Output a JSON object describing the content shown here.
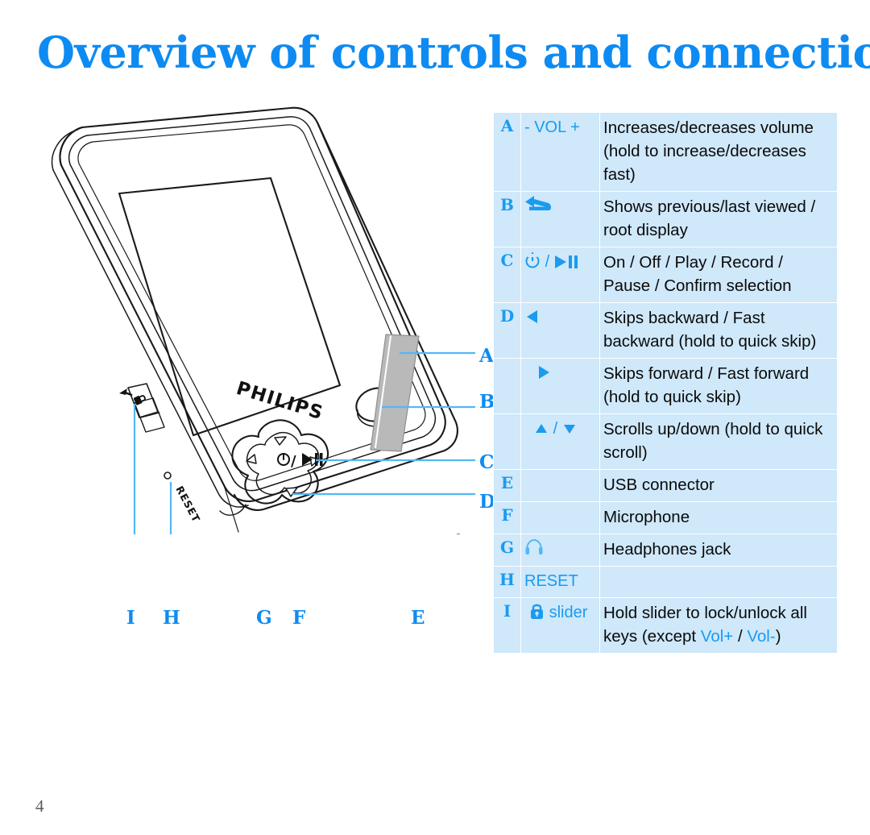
{
  "page": {
    "title": "Overview of controls and connections",
    "number": "4",
    "title_color": "#0d8bf2",
    "table_bg_color": "#cfe8fa",
    "accent_color": "#1a9bf0"
  },
  "figure": {
    "brand_label": "PHILIPS",
    "reset_label": "RESET",
    "center_button_label": "/",
    "callouts": [
      {
        "letter": "A",
        "target": "volume-strip"
      },
      {
        "letter": "B",
        "target": "back-button"
      },
      {
        "letter": "C",
        "target": "power-play-button"
      },
      {
        "letter": "D",
        "target": "navigation-pad"
      },
      {
        "letter": "E",
        "target": "usb-connector"
      },
      {
        "letter": "F",
        "target": "microphone"
      },
      {
        "letter": "G",
        "target": "headphones-jack"
      },
      {
        "letter": "H",
        "target": "reset-hole"
      },
      {
        "letter": "I",
        "target": "lock-slider"
      }
    ]
  },
  "table": {
    "rows": [
      {
        "letter": "A",
        "symbol_text": "- VOL +",
        "symbol_icon": "",
        "description": "Increases/decreases volume (hold to increase/decreases fast)"
      },
      {
        "letter": "B",
        "symbol_text": "",
        "symbol_icon": "back-arrow-icon",
        "description": "Shows previous/last viewed / root display"
      },
      {
        "letter": "C",
        "symbol_text": "/",
        "symbol_icon": "power-icon, play-pause-icon",
        "description": "On / Off / Play / Record / Pause / Confirm selection"
      },
      {
        "letter": "D",
        "symbol_text": "",
        "symbol_icon": "triangle-left-icon",
        "description": "Skips backward / Fast backward (hold to quick skip)"
      },
      {
        "letter": "",
        "symbol_text": "",
        "symbol_icon": "triangle-right-icon",
        "description": "Skips forward / Fast forward (hold to quick skip)"
      },
      {
        "letter": "",
        "symbol_text": "/",
        "symbol_icon": "triangle-up-icon, triangle-down-icon",
        "description": "Scrolls up/down (hold to quick scroll)"
      },
      {
        "letter": "E",
        "symbol_text": "",
        "symbol_icon": "",
        "description": "USB connector"
      },
      {
        "letter": "F",
        "symbol_text": "",
        "symbol_icon": "",
        "description": "Microphone"
      },
      {
        "letter": "G",
        "symbol_text": "",
        "symbol_icon": "headphones-icon",
        "description": "Headphones jack"
      },
      {
        "letter": "H",
        "symbol_text": "RESET",
        "symbol_icon": "",
        "description": ""
      },
      {
        "letter": "I",
        "symbol_text": "slider",
        "symbol_icon": "lock-icon",
        "description_parts": [
          {
            "text": "Hold slider to lock/unlock all keys (except ",
            "accent": false
          },
          {
            "text": "Vol+",
            "accent": true
          },
          {
            "text": " / ",
            "accent": false
          },
          {
            "text": "Vol-",
            "accent": true
          },
          {
            "text": ")",
            "accent": false
          }
        ],
        "description": "Hold slider to lock/unlock all keys (except Vol+ / Vol-)"
      }
    ]
  }
}
